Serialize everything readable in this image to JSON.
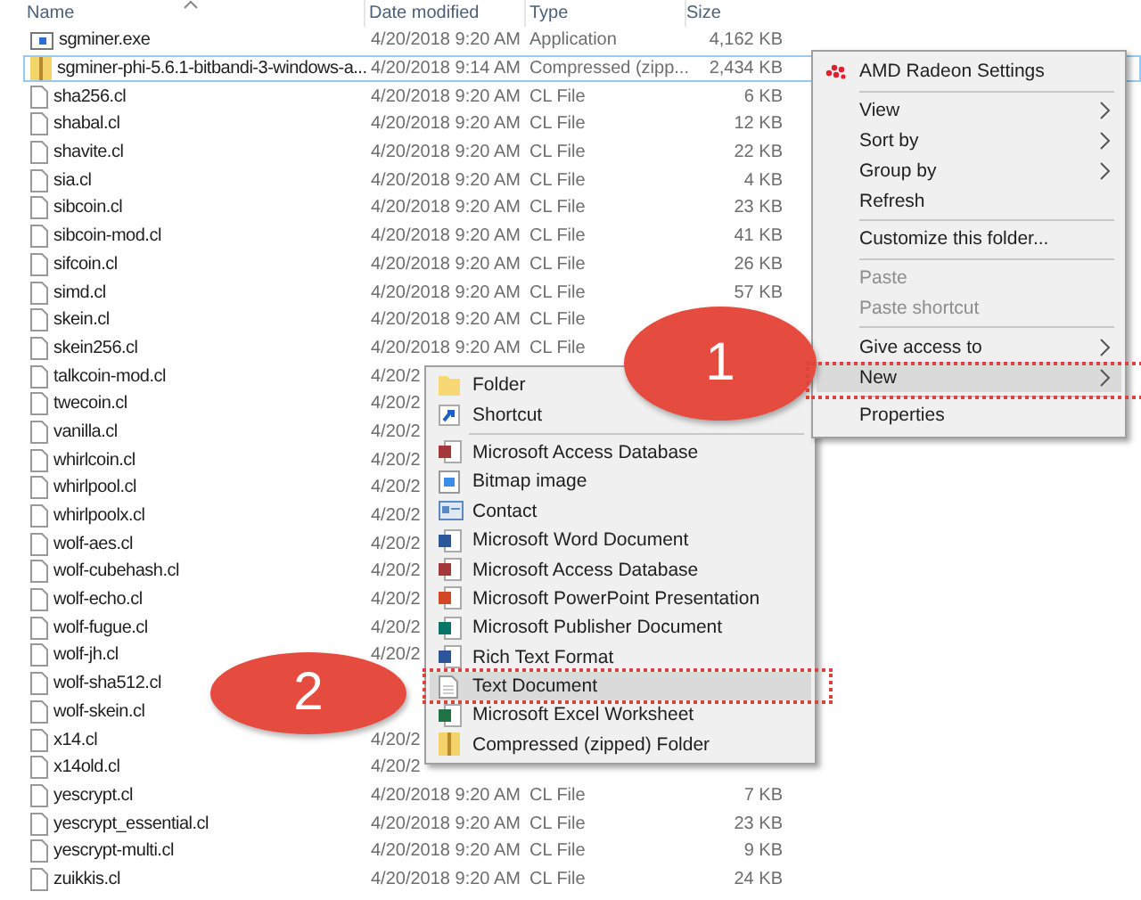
{
  "table": {
    "columns": [
      {
        "label": "Name"
      },
      {
        "label": "Date modified"
      },
      {
        "label": "Type"
      },
      {
        "label": "Size"
      }
    ],
    "rows": [
      {
        "kind": "exe",
        "name": "sgminer.exe",
        "date": "4/20/2018 9:20 AM",
        "type": "Application",
        "size": "4,162 KB",
        "focused": false
      },
      {
        "kind": "zip",
        "name": "sgminer-phi-5.6.1-bitbandi-3-windows-a...",
        "date": "4/20/2018 9:14 AM",
        "type": "Compressed (zipp...",
        "size": "2,434 KB",
        "focused": true
      },
      {
        "kind": "file",
        "name": "sha256.cl",
        "date": "4/20/2018 9:20 AM",
        "type": "CL File",
        "size": "6 KB",
        "focused": false
      },
      {
        "kind": "file",
        "name": "shabal.cl",
        "date": "4/20/2018 9:20 AM",
        "type": "CL File",
        "size": "12 KB",
        "focused": false
      },
      {
        "kind": "file",
        "name": "shavite.cl",
        "date": "4/20/2018 9:20 AM",
        "type": "CL File",
        "size": "22 KB",
        "focused": false
      },
      {
        "kind": "file",
        "name": "sia.cl",
        "date": "4/20/2018 9:20 AM",
        "type": "CL File",
        "size": "4 KB",
        "focused": false
      },
      {
        "kind": "file",
        "name": "sibcoin.cl",
        "date": "4/20/2018 9:20 AM",
        "type": "CL File",
        "size": "23 KB",
        "focused": false
      },
      {
        "kind": "file",
        "name": "sibcoin-mod.cl",
        "date": "4/20/2018 9:20 AM",
        "type": "CL File",
        "size": "41 KB",
        "focused": false
      },
      {
        "kind": "file",
        "name": "sifcoin.cl",
        "date": "4/20/2018 9:20 AM",
        "type": "CL File",
        "size": "26 KB",
        "focused": false
      },
      {
        "kind": "file",
        "name": "simd.cl",
        "date": "4/20/2018 9:20 AM",
        "type": "CL File",
        "size": "57 KB",
        "focused": false
      },
      {
        "kind": "file",
        "name": "skein.cl",
        "date": "4/20/2018 9:20 AM",
        "type": "CL File",
        "focused": false
      },
      {
        "kind": "file",
        "name": "skein256.cl",
        "date": "4/20/2018 9:20 AM",
        "type": "CL File",
        "focused": false
      },
      {
        "kind": "file",
        "name": "talkcoin-mod.cl",
        "date": "4/20/2",
        "focused": false
      },
      {
        "kind": "file",
        "name": "twecoin.cl",
        "date": "4/20/2",
        "focused": false
      },
      {
        "kind": "file",
        "name": "vanilla.cl",
        "date": "4/20/2",
        "focused": false
      },
      {
        "kind": "file",
        "name": "whirlcoin.cl",
        "date": "4/20/2",
        "focused": false
      },
      {
        "kind": "file",
        "name": "whirlpool.cl",
        "date": "4/20/2",
        "focused": false
      },
      {
        "kind": "file",
        "name": "whirlpoolx.cl",
        "date": "4/20/2",
        "focused": false
      },
      {
        "kind": "file",
        "name": "wolf-aes.cl",
        "date": "4/20/2",
        "focused": false
      },
      {
        "kind": "file",
        "name": "wolf-cubehash.cl",
        "date": "4/20/2",
        "focused": false
      },
      {
        "kind": "file",
        "name": "wolf-echo.cl",
        "date": "4/20/2",
        "focused": false
      },
      {
        "kind": "file",
        "name": "wolf-fugue.cl",
        "date": "4/20/2",
        "focused": false
      },
      {
        "kind": "file",
        "name": "wolf-jh.cl",
        "date": "4/20/2",
        "focused": false
      },
      {
        "kind": "file",
        "name": "wolf-sha512.cl",
        "focused": false
      },
      {
        "kind": "file",
        "name": "wolf-skein.cl",
        "focused": false
      },
      {
        "kind": "file",
        "name": "x14.cl",
        "date": "4/20/2",
        "focused": false
      },
      {
        "kind": "file",
        "name": "x14old.cl",
        "date": "4/20/2",
        "focused": false
      },
      {
        "kind": "file",
        "name": "yescrypt.cl",
        "date": "4/20/2018 9:20 AM",
        "type": "CL File",
        "size": "7 KB",
        "focused": false
      },
      {
        "kind": "file",
        "name": "yescrypt_essential.cl",
        "date": "4/20/2018 9:20 AM",
        "type": "CL File",
        "size": "23 KB",
        "focused": false
      },
      {
        "kind": "file",
        "name": "yescrypt-multi.cl",
        "date": "4/20/2018 9:20 AM",
        "type": "CL File",
        "size": "9 KB",
        "focused": false
      },
      {
        "kind": "file",
        "name": "zuikkis.cl",
        "date": "4/20/2018 9:20 AM",
        "type": "CL File",
        "size": "24 KB",
        "focused": false
      }
    ]
  },
  "context_menu": {
    "items": [
      {
        "kind": "app",
        "label": "AMD Radeon Settings",
        "submenu": false,
        "disabled": false,
        "selected": false
      },
      {
        "kind": "separator"
      },
      {
        "kind": "item",
        "label": "View",
        "submenu": true,
        "disabled": false,
        "selected": false
      },
      {
        "kind": "item",
        "label": "Sort by",
        "submenu": true,
        "disabled": false,
        "selected": false
      },
      {
        "kind": "item",
        "label": "Group by",
        "submenu": true,
        "disabled": false,
        "selected": false
      },
      {
        "kind": "item",
        "label": "Refresh",
        "submenu": false,
        "disabled": false,
        "selected": false
      },
      {
        "kind": "separator"
      },
      {
        "kind": "item",
        "label": "Customize this folder...",
        "submenu": false,
        "disabled": false,
        "selected": false
      },
      {
        "kind": "separator"
      },
      {
        "kind": "item",
        "label": "Paste",
        "submenu": false,
        "disabled": true,
        "selected": false
      },
      {
        "kind": "item",
        "label": "Paste shortcut",
        "submenu": false,
        "disabled": true,
        "selected": false
      },
      {
        "kind": "separator"
      },
      {
        "kind": "item",
        "label": "Give access to",
        "submenu": true,
        "disabled": false,
        "selected": false
      },
      {
        "kind": "item",
        "label": "New",
        "submenu": true,
        "disabled": false,
        "selected": true
      },
      {
        "kind": "separator"
      },
      {
        "kind": "item",
        "label": "Properties",
        "submenu": false,
        "disabled": false,
        "selected": false
      }
    ]
  },
  "new_submenu": {
    "items": [
      {
        "kind": "folder",
        "label": "Folder",
        "selected": false
      },
      {
        "kind": "shortcut",
        "label": "Shortcut",
        "selected": false
      },
      {
        "kind": "separator"
      },
      {
        "kind": "access",
        "label": "Microsoft Access Database",
        "selected": false
      },
      {
        "kind": "bitmap",
        "label": "Bitmap image",
        "selected": false
      },
      {
        "kind": "contact",
        "label": "Contact",
        "selected": false
      },
      {
        "kind": "word",
        "label": "Microsoft Word Document",
        "selected": false
      },
      {
        "kind": "access",
        "label": "Microsoft Access Database",
        "selected": false
      },
      {
        "kind": "powerpoint",
        "label": "Microsoft PowerPoint Presentation",
        "selected": false
      },
      {
        "kind": "publisher",
        "label": "Microsoft Publisher Document",
        "selected": false
      },
      {
        "kind": "rtf",
        "label": "Rich Text Format",
        "selected": false
      },
      {
        "kind": "text",
        "label": "Text Document",
        "selected": true
      },
      {
        "kind": "excel",
        "label": "Microsoft Excel Worksheet",
        "selected": false
      },
      {
        "kind": "zip",
        "label": "Compressed (zipped) Folder",
        "selected": false
      }
    ]
  },
  "callouts": [
    {
      "number": "1"
    },
    {
      "number": "2"
    }
  ]
}
